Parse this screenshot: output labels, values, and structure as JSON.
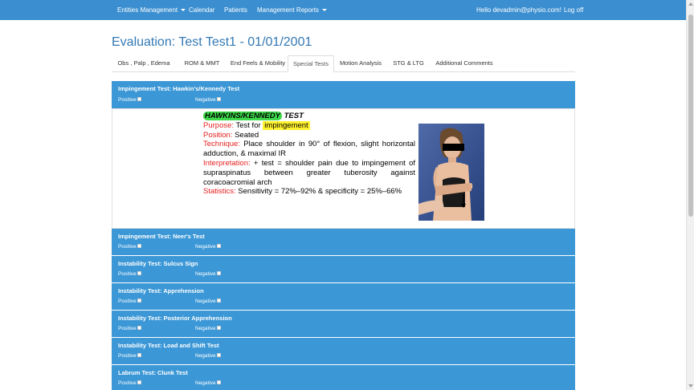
{
  "navbar": {
    "items": [
      {
        "label": "Entities Management",
        "dropdown": true
      },
      {
        "label": "Calendar",
        "dropdown": false
      },
      {
        "label": "Patients",
        "dropdown": false
      },
      {
        "label": "Management Reports",
        "dropdown": true
      }
    ],
    "greeting": "Hello devadmin@physio.com!",
    "logout": "Log off",
    "color": "#3b8fd0"
  },
  "page": {
    "title": "Evaluation: Test Test1 - 01/01/2001"
  },
  "tabs": [
    {
      "label": "Obs , Palp , Edema",
      "active": false
    },
    {
      "label": "ROM & MMT",
      "active": false
    },
    {
      "label": "End Feels & Mobility",
      "active": false
    },
    {
      "label": "Special Tests",
      "active": true
    },
    {
      "label": "Motion Analysis",
      "active": false
    },
    {
      "label": "STG & LTG",
      "active": false
    },
    {
      "label": "Additional Comments",
      "active": false
    }
  ],
  "tests": [
    {
      "title": "Impingement Test: Hawkin's/Kennedy Test",
      "positive": "Positive",
      "negative": "Negative"
    },
    {
      "title": "Impingement Test: Neer's Test",
      "positive": "Positive",
      "negative": "Negative"
    },
    {
      "title": "Instability Test: Sulcus Sign",
      "positive": "Positive",
      "negative": "Negative"
    },
    {
      "title": "Instability Test: Apprehension",
      "positive": "Positive",
      "negative": "Negative"
    },
    {
      "title": "Instability Test: Posterior Apprehension",
      "positive": "Positive",
      "negative": "Negative"
    },
    {
      "title": "Instability Test: Load and Shift Test",
      "positive": "Positive",
      "negative": "Negative"
    },
    {
      "title": "Labrum Test: Clunk Test",
      "positive": "Positive",
      "negative": "Negative"
    }
  ],
  "card": {
    "title_highlight": "HAWKINS/KENNEDY",
    "title_rest": "TEST",
    "purpose_label": "Purpose:",
    "purpose_text": "Test for",
    "purpose_highlight": "impingement",
    "position_label": "Position:",
    "position_text": "Seated",
    "technique_label": "Technique:",
    "technique_text": "Place shoulder in 90° of flexion, slight horizontal adduction, & maximal IR",
    "interpretation_label": "Interpretation:",
    "interpretation_text": "+ test = shoulder pain due to impingement of supraspinatus between greater tuberosity against coracoacromial arch",
    "statistics_label": "Statistics:",
    "statistics_text": "Sensitivity = 72%–92% & specificity = 25%–66%"
  },
  "colors": {
    "panel": "#3b97d6",
    "title": "#3379b4",
    "label_red": "#e52020",
    "highlight_green": "#3dd94a",
    "highlight_yellow": "#fff22e"
  }
}
